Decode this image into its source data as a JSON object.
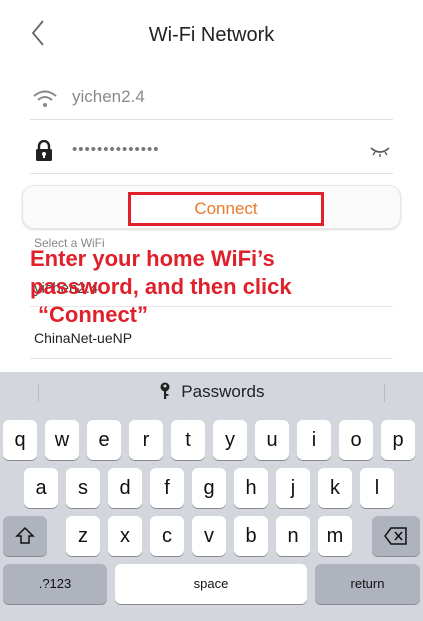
{
  "header": {
    "title": "Wi-Fi Network",
    "back_icon": "chevron-left-icon"
  },
  "ssid": {
    "value": "yichen2.4",
    "icon": "wifi-icon"
  },
  "password": {
    "masked_value": "••••••••••••••",
    "icon": "lock-icon",
    "toggle_icon": "eye-closed-icon"
  },
  "connect": {
    "label": "Connect",
    "accent": "#e87a2a",
    "highlight": "#e0202a"
  },
  "wifi_list": {
    "label": "Select a WiFi",
    "items": [
      "yichen2.4",
      "ChinaNet-ueNP"
    ]
  },
  "annotation": {
    "text_line1": "Enter your home WiFi’s",
    "text_line2": "password, and then click",
    "text_line3": "“Connect”"
  },
  "keyboard": {
    "passwords_label": "Passwords",
    "row1": [
      "q",
      "w",
      "e",
      "r",
      "t",
      "y",
      "u",
      "i",
      "o",
      "p"
    ],
    "row2": [
      "a",
      "s",
      "d",
      "f",
      "g",
      "h",
      "j",
      "k",
      "l"
    ],
    "row3": [
      "z",
      "x",
      "c",
      "v",
      "b",
      "n",
      "m"
    ],
    "numbers_key": ".?123",
    "space_key": "space",
    "return_key": "return"
  }
}
